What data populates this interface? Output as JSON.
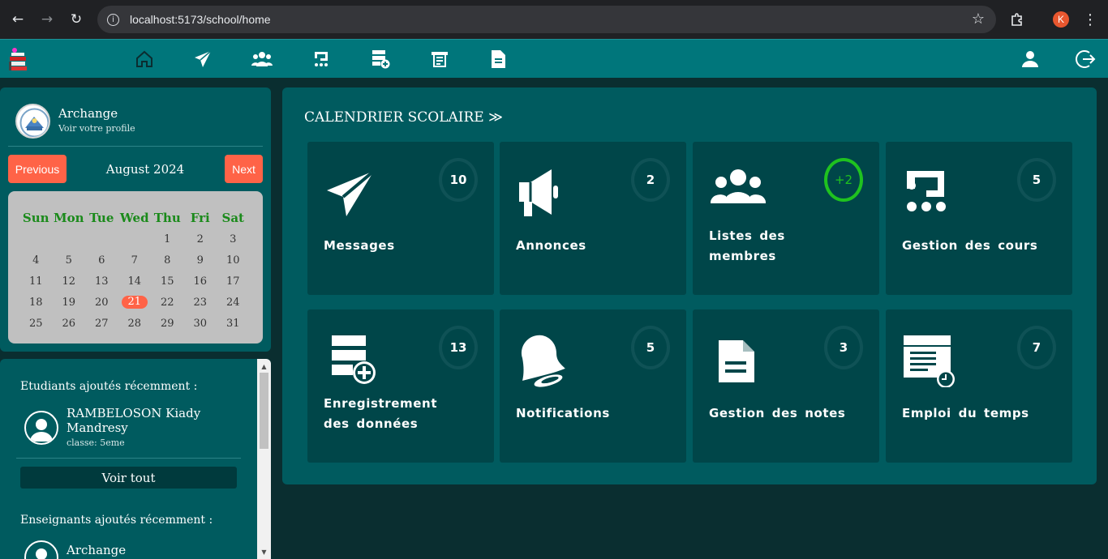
{
  "browser": {
    "url": "localhost:5173/school/home",
    "profile_initial": "K"
  },
  "nav": {
    "icons": [
      "home-icon",
      "send-icon",
      "users-icon",
      "course-icon",
      "data-add-icon",
      "timetable-icon",
      "document-icon",
      "user-icon",
      "logout-icon"
    ]
  },
  "profile": {
    "name": "Archange",
    "subtitle": "Voir votre profile"
  },
  "calendar": {
    "prev_label": "Previous",
    "next_label": "Next",
    "month_label": "August 2024",
    "weekdays": [
      "Sun",
      "Mon",
      "Tue",
      "Wed",
      "Thu",
      "Fri",
      "Sat"
    ],
    "weeks": [
      [
        "",
        "",
        "",
        "",
        "1",
        "2",
        "3"
      ],
      [
        "4",
        "5",
        "6",
        "7",
        "8",
        "9",
        "10"
      ],
      [
        "11",
        "12",
        "13",
        "14",
        "15",
        "16",
        "17"
      ],
      [
        "18",
        "19",
        "20",
        "21",
        "22",
        "23",
        "24"
      ],
      [
        "25",
        "26",
        "27",
        "28",
        "29",
        "30",
        "31"
      ]
    ],
    "today": "21",
    "accent": "#ff6347"
  },
  "recent": {
    "students_title": "Etudiants ajoutés récemment :",
    "student_name": "RAMBELOSON Kiady Mandresy",
    "student_class": "classe: 5eme",
    "see_all": "Voir tout",
    "teachers_title": "Enseignants ajoutés récemment :",
    "teacher_name": "Archange"
  },
  "main": {
    "title": "CALENDRIER SCOLAIRE ≫",
    "cards": [
      {
        "label": "Messages",
        "count": "10",
        "icon": "paper-plane-icon"
      },
      {
        "label": "Annonces",
        "count": "2",
        "icon": "megaphone-icon"
      },
      {
        "label": "Listes des membres",
        "count": "+2",
        "icon": "users-icon"
      },
      {
        "label": "Gestion des cours",
        "count": "5",
        "icon": "course-icon"
      },
      {
        "label": "Enregistrement des données",
        "count": "13",
        "icon": "data-add-icon"
      },
      {
        "label": "Notifications",
        "count": "5",
        "icon": "bell-icon"
      },
      {
        "label": "Gestion des notes",
        "count": "3",
        "icon": "document-icon"
      },
      {
        "label": "Emploi du temps",
        "count": "7",
        "icon": "timetable-icon"
      }
    ]
  }
}
